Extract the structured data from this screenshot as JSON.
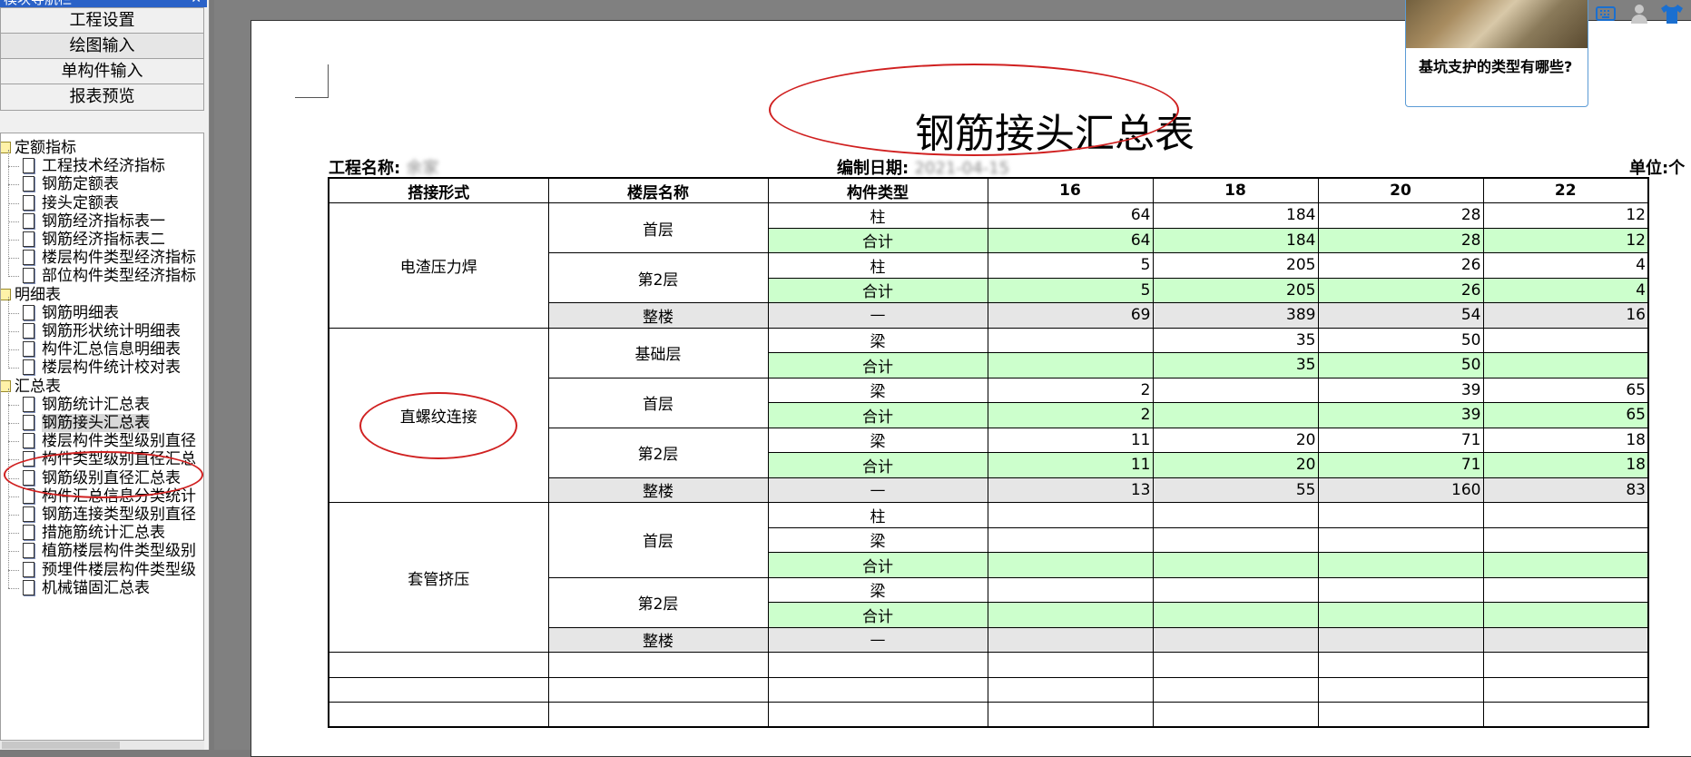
{
  "panel": {
    "title": "模块导航栏",
    "controls": "ꟷ ✕"
  },
  "nav_buttons": [
    "工程设置",
    "绘图输入",
    "单构件输入",
    "报表预览"
  ],
  "tree": {
    "groups": [
      {
        "label": "定额指标",
        "items": [
          "工程技术经济指标",
          "钢筋定额表",
          "接头定额表",
          "钢筋经济指标表一",
          "钢筋经济指标表二",
          "楼层构件类型经济指标",
          "部位构件类型经济指标"
        ]
      },
      {
        "label": "明细表",
        "items": [
          "钢筋明细表",
          "钢筋形状统计明细表",
          "构件汇总信息明细表",
          "楼层构件统计校对表"
        ]
      },
      {
        "label": "汇总表",
        "items": [
          "钢筋统计汇总表",
          "钢筋接头汇总表",
          "楼层构件类型级别直径",
          "构件类型级别直径汇总",
          "钢筋级别直径汇总表",
          "构件汇总信息分类统计",
          "钢筋连接类型级别直径",
          "措施筋统计汇总表",
          "植筋楼层构件类型级别",
          "预埋件楼层构件类型级",
          "机械锚固汇总表"
        ]
      }
    ],
    "selected": "钢筋接头汇总表"
  },
  "report": {
    "title": "钢筋接头汇总表",
    "project_label": "工程名称:",
    "project_value": "余家",
    "date_label": "编制日期:",
    "date_value": "2021-04-15",
    "unit_label": "单位:个",
    "headers": [
      "搭接形式",
      "楼层名称",
      "构件类型",
      "16",
      "18",
      "20",
      "22"
    ],
    "groups": [
      {
        "type": "电渣压力焊",
        "floors": [
          {
            "name": "首层",
            "rows": [
              {
                "comp": "柱",
                "v": [
                  "64",
                  "184",
                  "28",
                  "12"
                ]
              },
              {
                "comp": "合计",
                "v": [
                  "64",
                  "184",
                  "28",
                  "12"
                ],
                "sub": true
              }
            ]
          },
          {
            "name": "第2层",
            "rows": [
              {
                "comp": "柱",
                "v": [
                  "5",
                  "205",
                  "26",
                  "4"
                ]
              },
              {
                "comp": "合计",
                "v": [
                  "5",
                  "205",
                  "26",
                  "4"
                ],
                "sub": true
              }
            ]
          },
          {
            "name": "整楼",
            "total": true,
            "rows": [
              {
                "comp": "—",
                "v": [
                  "69",
                  "389",
                  "54",
                  "16"
                ]
              }
            ]
          }
        ]
      },
      {
        "type": "直螺纹连接",
        "floors": [
          {
            "name": "基础层",
            "rows": [
              {
                "comp": "梁",
                "v": [
                  "",
                  "35",
                  "50",
                  ""
                ]
              },
              {
                "comp": "合计",
                "v": [
                  "",
                  "35",
                  "50",
                  ""
                ],
                "sub": true
              }
            ]
          },
          {
            "name": "首层",
            "rows": [
              {
                "comp": "梁",
                "v": [
                  "2",
                  "",
                  "39",
                  "65"
                ]
              },
              {
                "comp": "合计",
                "v": [
                  "2",
                  "",
                  "39",
                  "65"
                ],
                "sub": true
              }
            ]
          },
          {
            "name": "第2层",
            "rows": [
              {
                "comp": "梁",
                "v": [
                  "11",
                  "20",
                  "71",
                  "18"
                ]
              },
              {
                "comp": "合计",
                "v": [
                  "11",
                  "20",
                  "71",
                  "18"
                ],
                "sub": true
              }
            ]
          },
          {
            "name": "整楼",
            "total": true,
            "rows": [
              {
                "comp": "—",
                "v": [
                  "13",
                  "55",
                  "160",
                  "83"
                ]
              }
            ]
          }
        ]
      },
      {
        "type": "套管挤压",
        "floors": [
          {
            "name": "首层",
            "rows": [
              {
                "comp": "柱",
                "v": [
                  "",
                  "",
                  "",
                  ""
                ]
              },
              {
                "comp": "梁",
                "v": [
                  "",
                  "",
                  "",
                  ""
                ]
              },
              {
                "comp": "合计",
                "v": [
                  "",
                  "",
                  "",
                  ""
                ],
                "sub": true
              }
            ]
          },
          {
            "name": "第2层",
            "rows": [
              {
                "comp": "梁",
                "v": [
                  "",
                  "",
                  "",
                  ""
                ]
              },
              {
                "comp": "合计",
                "v": [
                  "",
                  "",
                  "",
                  ""
                ],
                "sub": true
              }
            ]
          },
          {
            "name": "整楼",
            "total": true,
            "rows": [
              {
                "comp": "—",
                "v": [
                  "",
                  "",
                  "",
                  ""
                ]
              }
            ]
          }
        ]
      }
    ],
    "empty_rows": 3
  },
  "card": {
    "text": "基坑支护的类型有哪些?"
  },
  "icons": [
    "keyboard-icon",
    "user-icon",
    "shirt-icon"
  ],
  "colors": {
    "subtotal_bg": "#ccffcc",
    "total_bg": "#e6e6e6",
    "annotation": "#d02020",
    "accent": "#2a62c8"
  }
}
